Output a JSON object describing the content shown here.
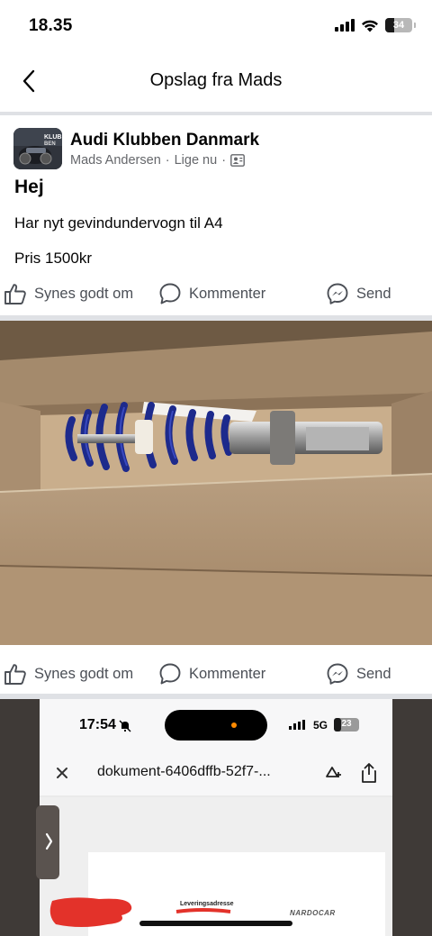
{
  "status_bar": {
    "time": "18.35",
    "battery": "34",
    "battery_level": 0.34
  },
  "header": {
    "title": "Opslag fra Mads"
  },
  "post": {
    "group": "Audi Klubben Danmark",
    "author": "Mads Andersen",
    "time": "Lige nu",
    "title": "Hej",
    "lines": [
      "Har nyt gevindundervogn til A4",
      "Pris 1500kr"
    ],
    "avatar_text": "KLUBBEN"
  },
  "actions": {
    "like": "Synes godt om",
    "comment": "Kommenter",
    "send": "Send"
  },
  "embedded_screenshot": {
    "time": "17:54",
    "network": "5G",
    "battery": "23",
    "doc_title": "dokument-6406dffb-52f7-...",
    "delivery_label": "Leveringsadresse",
    "brand": "NARDOCAR"
  },
  "colors": {
    "divider": "#dfe1e5",
    "meta_text": "#65676b",
    "action_text": "#4b4f56",
    "spring_blue": "#1d2a8c"
  }
}
